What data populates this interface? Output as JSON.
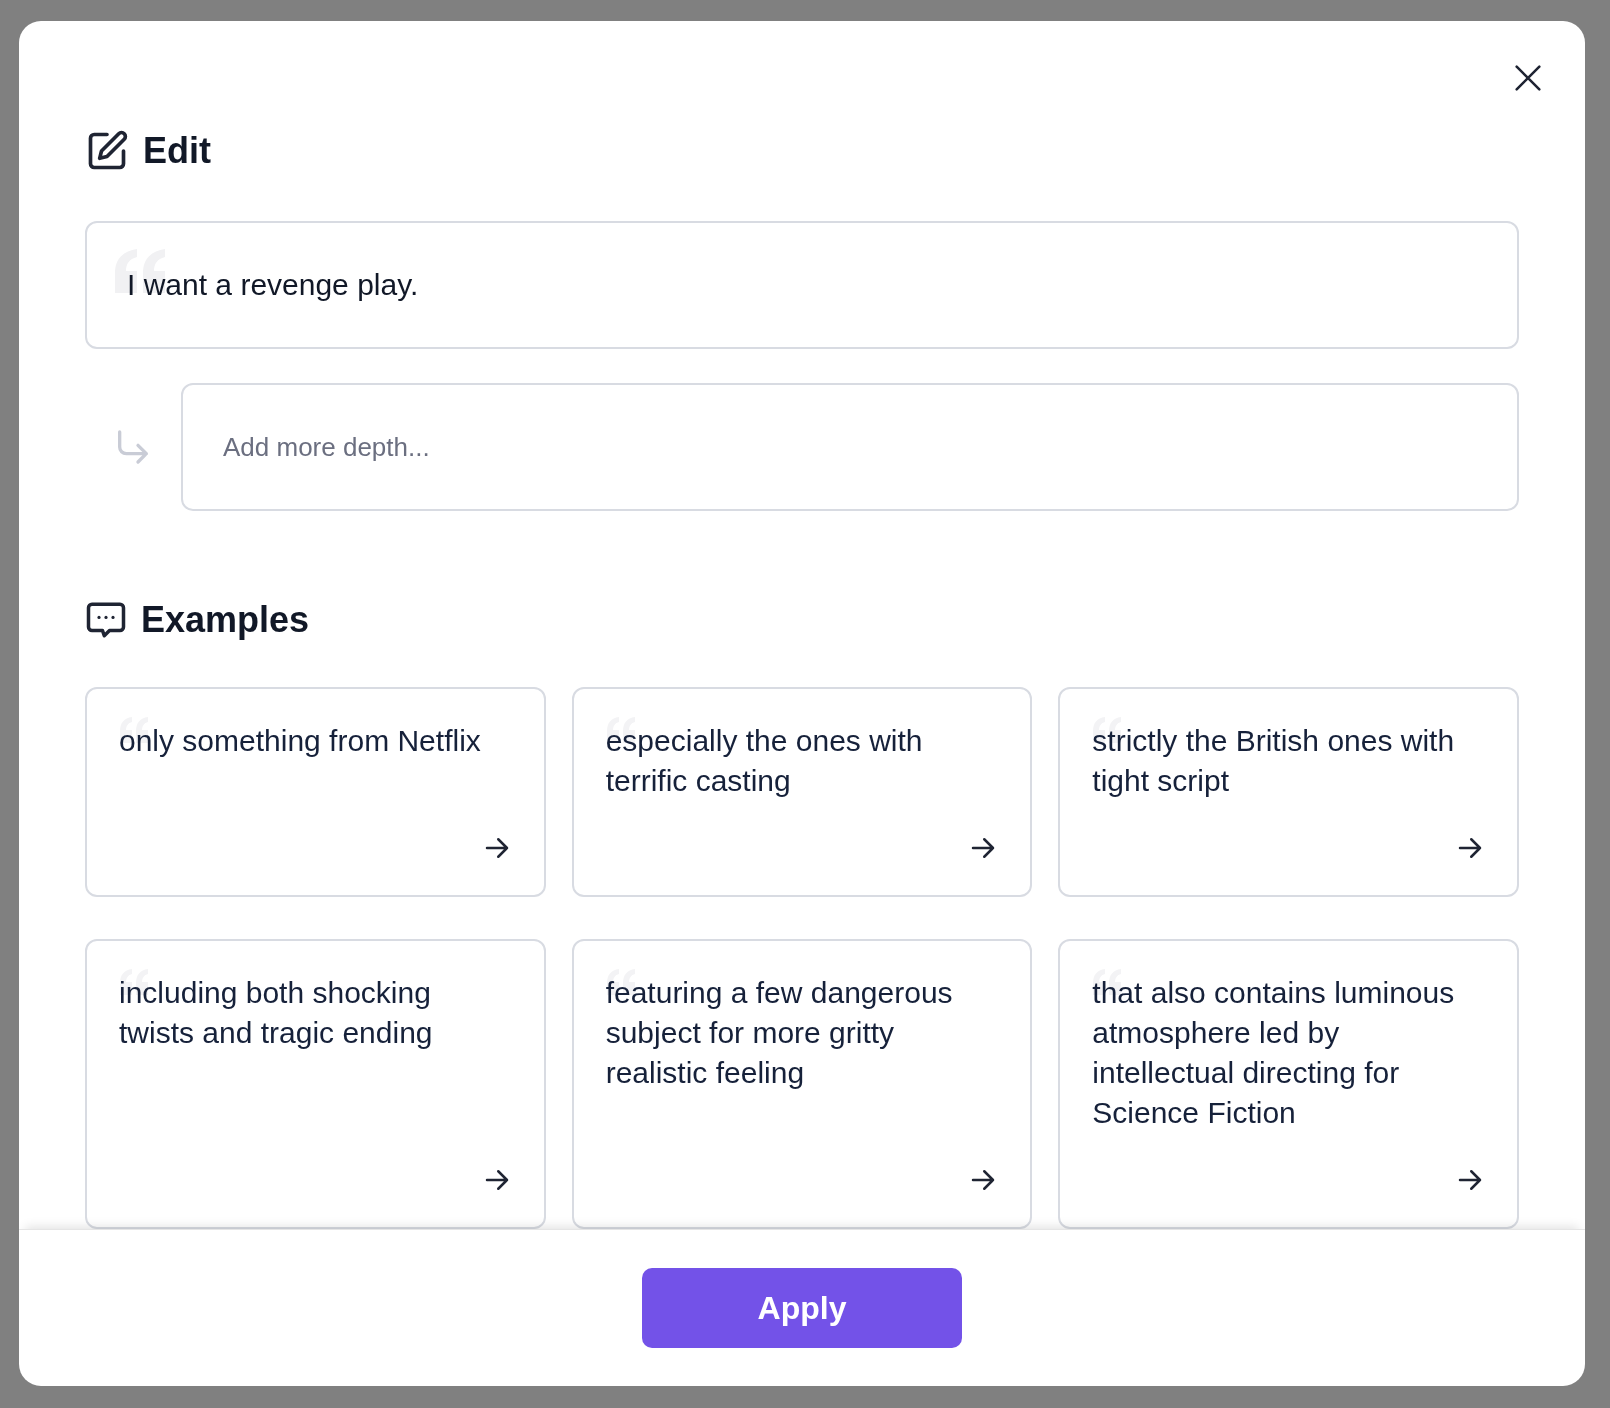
{
  "edit": {
    "title": "Edit",
    "prompt": "I want a revenge play.",
    "depth_field": {
      "placeholder": "Add more depth..."
    }
  },
  "examples": {
    "title": "Examples",
    "items": [
      {
        "text": "only something from Netflix"
      },
      {
        "text": "especially the ones with terrific casting"
      },
      {
        "text": "strictly the British ones with tight script"
      },
      {
        "text": "including both shocking twists and tragic ending"
      },
      {
        "text": "featuring a few dangerous subject for more gritty realistic feeling"
      },
      {
        "text": "that also contains luminous atmosphere led by intellectual directing for Science Fiction"
      }
    ]
  },
  "footer": {
    "apply_button": "Apply"
  }
}
